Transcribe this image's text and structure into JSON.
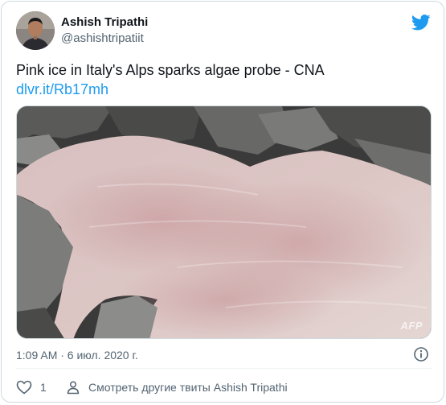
{
  "author": {
    "display_name": "Ashish Tripathi",
    "handle": "@ashishtripatiit"
  },
  "tweet": {
    "text": "Pink ice in Italy's Alps sparks algae probe - CNA",
    "link": "dlvr.it/Rb17mh",
    "timestamp": "1:09 AM · 6 июл. 2020 г."
  },
  "media": {
    "watermark": "AFP"
  },
  "actions": {
    "like_count": "1",
    "more_tweets_label": "Смотреть другие твиты Ashish Tripathi"
  },
  "colors": {
    "brand": "#1d9bf0",
    "text_primary": "#0f1419",
    "text_secondary": "#536471"
  },
  "icons": [
    "twitter-bird-icon",
    "info-icon",
    "heart-icon",
    "person-icon"
  ]
}
